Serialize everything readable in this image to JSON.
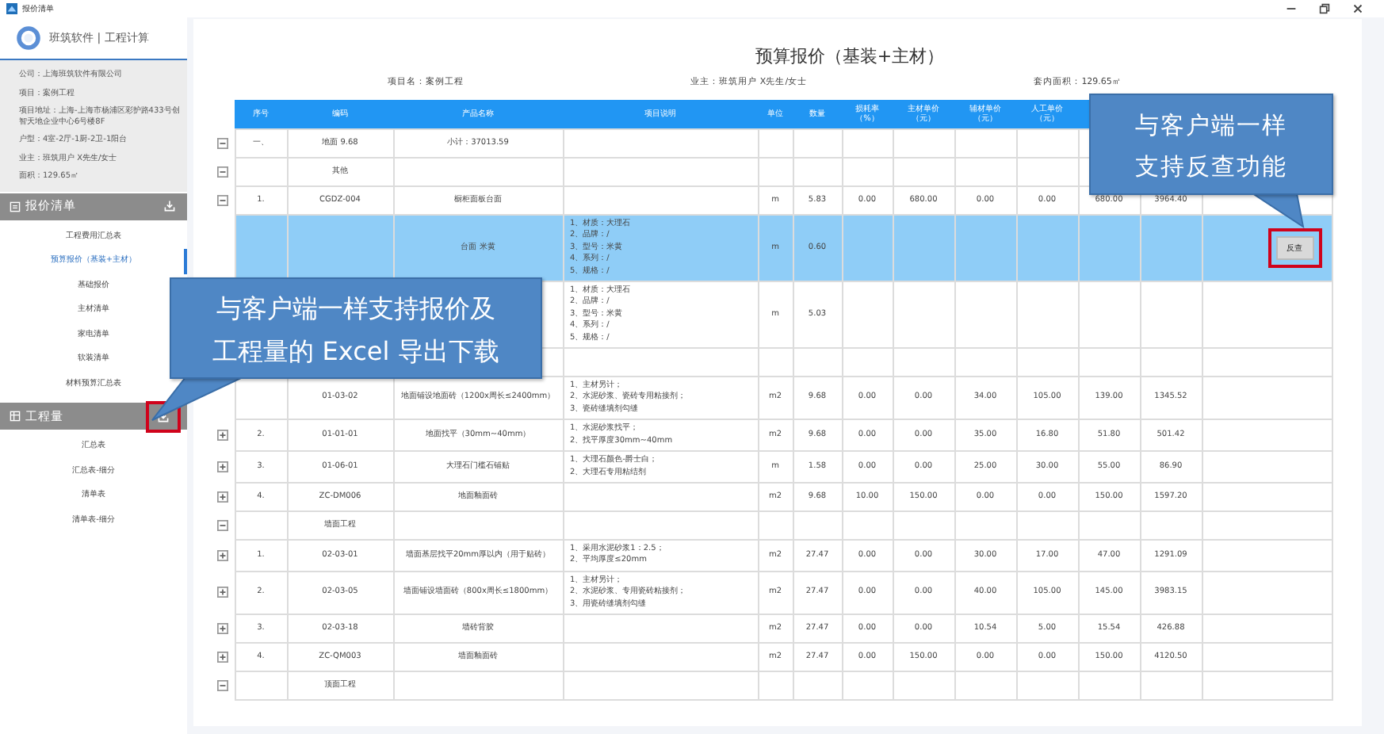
{
  "window": {
    "title": "报价清单"
  },
  "sidebar": {
    "brand": "班筑软件 | 工程计算",
    "info": [
      "公司：上海班筑软件有限公司",
      "项目：案例工程",
      "项目地址：上海-上海市杨浦区彩护路433号创智天地企业中心6号楼8F",
      "户型：4室-2厅-1厨-2卫-1阳台",
      "业主：班筑用户 X先生/女士",
      "面积：129.65㎡"
    ],
    "sections": [
      {
        "title": "报价清单",
        "download_highlighted": false,
        "items": [
          {
            "label": "工程费用汇总表",
            "selected": false
          },
          {
            "label": "预算报价（基装+主材）",
            "selected": true
          },
          {
            "label": "基础报价",
            "selected": false
          },
          {
            "label": "主材清单",
            "selected": false
          },
          {
            "label": "家电清单",
            "selected": false
          },
          {
            "label": "软装清单",
            "selected": false
          },
          {
            "label": "材料预算汇总表",
            "selected": false
          }
        ]
      },
      {
        "title": "工程量",
        "download_highlighted": true,
        "items": [
          {
            "label": "汇总表",
            "selected": false
          },
          {
            "label": "汇总表-细分",
            "selected": false
          },
          {
            "label": "清单表",
            "selected": false
          },
          {
            "label": "清单表-细分",
            "selected": false
          }
        ]
      }
    ]
  },
  "report": {
    "title": "预算报价（基装+主材）",
    "meta": [
      "项目名：案例工程",
      "业主：班筑用户 X先生/女士",
      "套内面积：129.65㎡"
    ],
    "columns": [
      "序号",
      "编码",
      "产品名称",
      "项目说明",
      "单位",
      "数量",
      "损耗率（%）",
      "主材单价（元）",
      "辅材单价（元）",
      "人工单价（元）"
    ],
    "rows": [
      {
        "expanded": true,
        "selected": false,
        "seq": "一、",
        "code": "地面 9.68",
        "name": "小计：37013.59"
      },
      {
        "expanded": true,
        "selected": false,
        "code": "其他"
      },
      {
        "expanded": true,
        "selected": false,
        "seq": "1.",
        "code": "CGDZ-004",
        "name": "橱柜面板台面",
        "unit": "m",
        "qty": "5.83",
        "loss": "0.00",
        "main": "680.00",
        "aux": "0.00",
        "labor": "0.00",
        "price": "680.00",
        "total": "3964.40"
      },
      {
        "selected": true,
        "name": "台面 米黄",
        "desc": "1、材质：大理石\n2、品牌：/\n3、型号：米黄\n4、系列：/\n5、规格：/",
        "unit": "m",
        "qty": "0.60",
        "action": "反查",
        "action_highlighted": true
      },
      {
        "selected": false,
        "desc": "1、材质：大理石\n2、品牌：/\n3、型号：米黄\n4、系列：/\n5、规格：/",
        "unit": "m",
        "qty": "5.03"
      },
      {
        "selected": false
      },
      {
        "selected": false,
        "code": "01-03-02",
        "name": "地面铺设地面砖（1200x周长≤2400mm）",
        "desc": "1、主材另计；\n2、水泥砂浆、瓷砖专用粘接剂；\n3、瓷砖缝填剂勾缝",
        "unit": "m2",
        "qty": "9.68",
        "loss": "0.00",
        "main": "0.00",
        "aux": "34.00",
        "labor": "105.00",
        "price": "139.00",
        "total": "1345.52"
      },
      {
        "expanded": false,
        "selected": false,
        "seq": "2.",
        "code": "01-01-01",
        "name": "地面找平（30mm~40mm）",
        "desc": "1、水泥砂浆找平；\n2、找平厚度30mm~40mm",
        "unit": "m2",
        "qty": "9.68",
        "loss": "0.00",
        "main": "0.00",
        "aux": "35.00",
        "labor": "16.80",
        "price": "51.80",
        "total": "501.42"
      },
      {
        "expanded": false,
        "selected": false,
        "seq": "3.",
        "code": "01-06-01",
        "name": "大理石门槛石铺贴",
        "desc": "1、大理石颜色-爵士白；\n2、大理石专用粘结剂",
        "unit": "m",
        "qty": "1.58",
        "loss": "0.00",
        "main": "0.00",
        "aux": "25.00",
        "labor": "30.00",
        "price": "55.00",
        "total": "86.90"
      },
      {
        "expanded": false,
        "selected": false,
        "seq": "4.",
        "code": "ZC-DM006",
        "name": "地面釉面砖",
        "unit": "m2",
        "qty": "9.68",
        "loss": "10.00",
        "main": "150.00",
        "aux": "0.00",
        "labor": "0.00",
        "price": "150.00",
        "total": "1597.20"
      },
      {
        "expanded": true,
        "selected": false,
        "code": "墙面工程"
      },
      {
        "expanded": false,
        "selected": false,
        "seq": "1.",
        "code": "02-03-01",
        "name": "墙面基层找平20mm厚以内（用于贴砖）",
        "desc": "1、采用水泥砂浆1：2.5；\n2、平均厚度≤20mm",
        "unit": "m2",
        "qty": "27.47",
        "loss": "0.00",
        "main": "0.00",
        "aux": "30.00",
        "labor": "17.00",
        "price": "47.00",
        "total": "1291.09"
      },
      {
        "expanded": false,
        "selected": false,
        "seq": "2.",
        "code": "02-03-05",
        "name": "墙面铺设墙面砖（800x周长≤1800mm）",
        "desc": "1、主材另计；\n2、水泥砂浆、专用瓷砖粘接剂；\n3、用瓷砖缝填剂勾缝",
        "unit": "m2",
        "qty": "27.47",
        "loss": "0.00",
        "main": "0.00",
        "aux": "40.00",
        "labor": "105.00",
        "price": "145.00",
        "total": "3983.15"
      },
      {
        "expanded": false,
        "selected": false,
        "seq": "3.",
        "code": "02-03-18",
        "name": "墙砖背胶",
        "unit": "m2",
        "qty": "27.47",
        "loss": "0.00",
        "main": "0.00",
        "aux": "10.54",
        "labor": "5.00",
        "price": "15.54",
        "total": "426.88"
      },
      {
        "expanded": false,
        "selected": false,
        "seq": "4.",
        "code": "ZC-QM003",
        "name": "墙面釉面砖",
        "unit": "m2",
        "qty": "27.47",
        "loss": "0.00",
        "main": "150.00",
        "aux": "0.00",
        "labor": "0.00",
        "price": "150.00",
        "total": "4120.50"
      },
      {
        "expanded": true,
        "selected": false,
        "code": "顶面工程"
      }
    ]
  },
  "callouts": [
    {
      "lines": [
        "与客户端一样",
        "支持反查功能"
      ]
    },
    {
      "lines": [
        "与客户端一样支持报价及",
        "工程量的 Excel 导出下载"
      ]
    }
  ]
}
